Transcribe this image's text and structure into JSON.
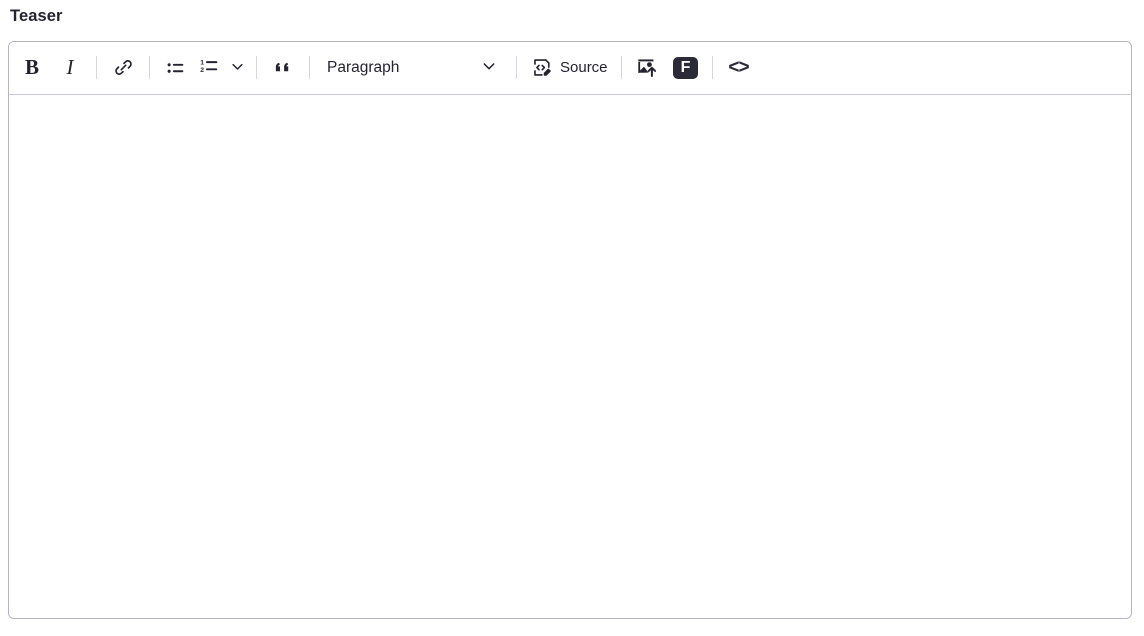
{
  "field": {
    "label": "Teaser"
  },
  "colors": {
    "text": "#23242e",
    "border": "#b1b4c4",
    "toolbar_divider": "#c9ccd8",
    "separator": "#d4d7e0",
    "badge_bg": "#2a2b37",
    "background": "#ffffff"
  },
  "toolbar": {
    "bold": {
      "label": "B",
      "title": "Bold",
      "icon": "bold-icon"
    },
    "italic": {
      "label": "I",
      "title": "Italic",
      "icon": "italic-icon"
    },
    "link": {
      "title": "Link",
      "icon": "link-icon"
    },
    "bulleted_list": {
      "title": "Bulleted List",
      "icon": "bulleted-list-icon"
    },
    "numbered_list": {
      "title": "Numbered List",
      "icon": "numbered-list-icon"
    },
    "list_dropdown": {
      "title": "List options",
      "icon": "chevron-down-icon"
    },
    "blockquote": {
      "label": "“",
      "title": "Block quote",
      "icon": "blockquote-icon"
    },
    "paragraph_format": {
      "value": "Paragraph",
      "title": "Paragraph format",
      "icon": "chevron-down-icon"
    },
    "source": {
      "label": "Source",
      "title": "Source",
      "icon": "source-code-edit-icon"
    },
    "insert_image": {
      "title": "Insert image",
      "icon": "image-upload-icon"
    },
    "font_plugin": {
      "label": "F",
      "title": "Font",
      "icon": "f-badge-icon"
    },
    "code_block": {
      "label": "<>",
      "title": "Code",
      "icon": "code-brackets-icon"
    }
  },
  "editor": {
    "content": "",
    "placeholder": ""
  }
}
